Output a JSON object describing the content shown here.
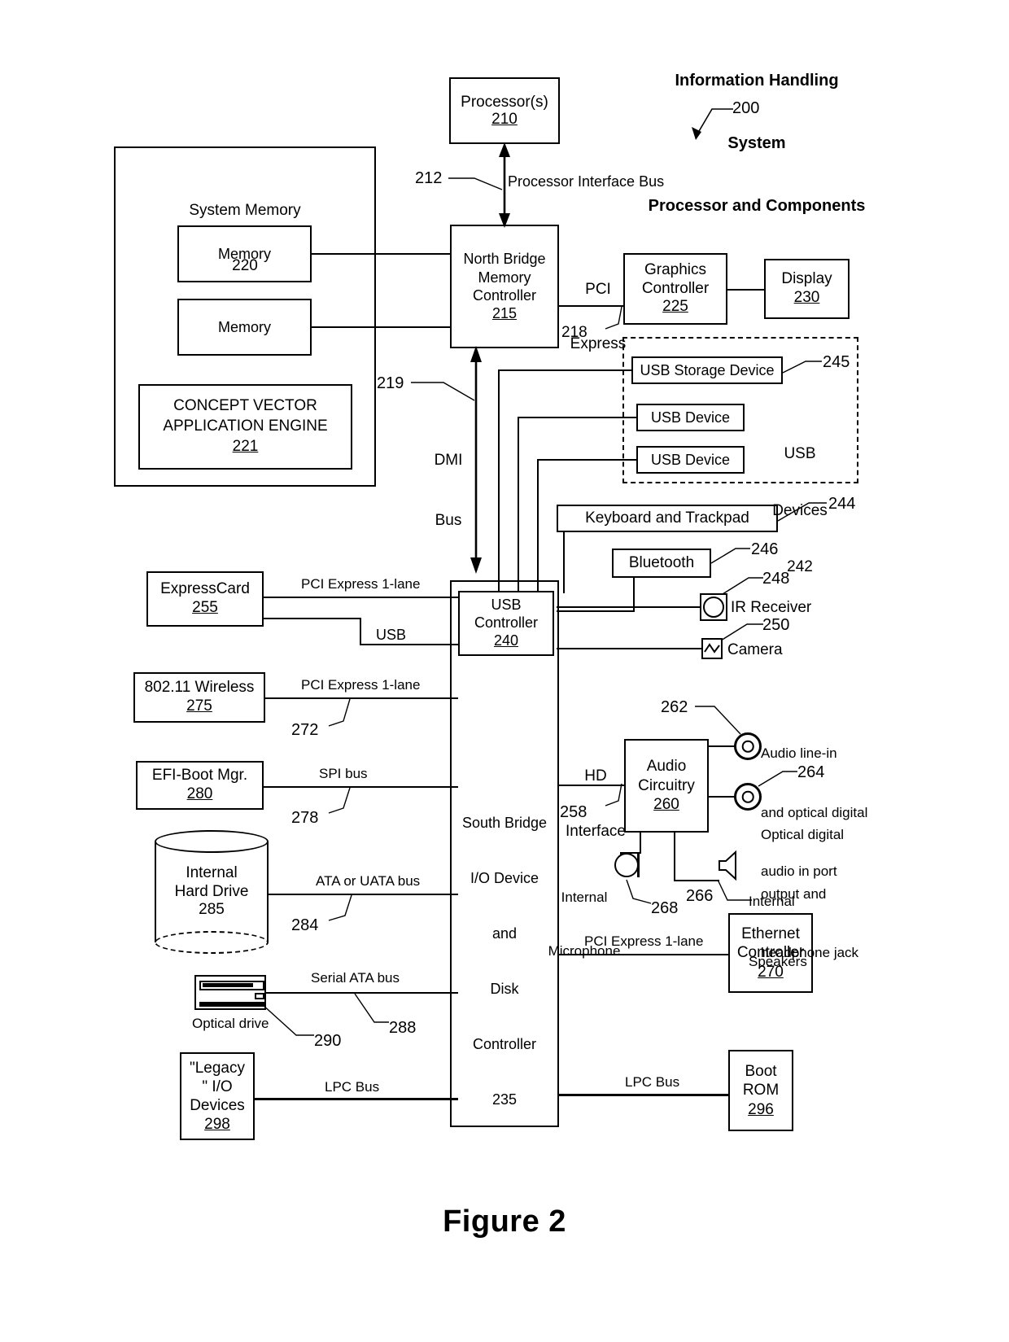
{
  "figure": {
    "label": "Figure 2",
    "title_lines": [
      "Information Handling",
      "System",
      "Processor and Components"
    ],
    "title_ref": "200"
  },
  "blocks": {
    "processor": {
      "name": "Processor(s)",
      "ref": "210"
    },
    "system_memory": {
      "name": "System Memory",
      "ref": "220"
    },
    "memory_1": {
      "name": "Memory"
    },
    "memory_2": {
      "name": "Memory"
    },
    "concept_vector": {
      "line1": "CONCEPT VECTOR",
      "line2": "APPLICATION ENGINE",
      "ref": "221"
    },
    "north_bridge": {
      "line1": "North Bridge",
      "line2": "Memory",
      "line3": "Controller",
      "ref": "215"
    },
    "graphics_controller": {
      "line1": "Graphics",
      "line2": "Controller",
      "ref": "225"
    },
    "display": {
      "name": "Display",
      "ref": "230"
    },
    "usb_storage_device": {
      "name": "USB Storage Device"
    },
    "usb_device_1": {
      "name": "USB Device"
    },
    "usb_device_2": {
      "name": "USB Device"
    },
    "usb_devices_group": {
      "line1": "USB",
      "line2": "Devices",
      "ref": "242"
    },
    "keyboard_trackpad": {
      "name": "Keyboard and Trackpad"
    },
    "bluetooth": {
      "name": "Bluetooth"
    },
    "ir_receiver": {
      "name": "IR Receiver"
    },
    "camera": {
      "name": "Camera"
    },
    "usb_controller": {
      "line1": "USB",
      "line2": "Controller",
      "ref": "240"
    },
    "south_bridge": {
      "line1": "South Bridge",
      "line2": "I/O Device",
      "line3": "and",
      "line4": "Disk",
      "line5": "Controller",
      "ref": "235"
    },
    "expresscard": {
      "name": "ExpressCard",
      "ref": "255"
    },
    "wireless": {
      "name": "802.11 Wireless",
      "ref": "275"
    },
    "efi_boot_mgr": {
      "name": "EFI-Boot Mgr.",
      "ref": "280"
    },
    "internal_hard_drive": {
      "line1": "Internal",
      "line2": "Hard Drive",
      "ref": "285"
    },
    "optical_drive": {
      "name": "Optical drive"
    },
    "legacy_io": {
      "line1": "\"Legacy",
      "line2": "\" I/O",
      "line3": "Devices",
      "ref": "298"
    },
    "audio_circuitry": {
      "line1": "Audio",
      "line2": "Circuitry",
      "ref": "260"
    },
    "ethernet_controller": {
      "line1": "Ethernet",
      "line2": "Controller",
      "ref": "270"
    },
    "boot_rom": {
      "line1": "Boot",
      "line2": "ROM",
      "ref": "296"
    },
    "internal_microphone": {
      "line1": "Internal",
      "line2": "Microphone"
    },
    "internal_speakers": {
      "line1": "Internal",
      "line2": "Speakers"
    },
    "audio_line_in": {
      "line1": "Audio line-in",
      "line2": "and optical digital",
      "line3": "audio in port"
    },
    "optical_digital_out": {
      "line1": "Optical digital",
      "line2": "output and",
      "line3": "headphone jack"
    }
  },
  "bus_labels": {
    "processor_interface_bus": "Processor Interface Bus",
    "pci_express": {
      "line1": "PCI",
      "line2": "Express"
    },
    "dmi_bus": {
      "line1": "DMI",
      "line2": "Bus"
    },
    "pci_express_1lane_expresscard": "PCI Express 1-lane",
    "usb": "USB",
    "pci_express_1lane_wireless": "PCI Express 1-lane",
    "spi_bus": "SPI bus",
    "ata_uata_bus": "ATA or UATA bus",
    "serial_ata_bus": "Serial ATA bus",
    "lpc_bus_left": "LPC Bus",
    "lpc_bus_right": "LPC Bus",
    "hd_interface": {
      "line1": "HD",
      "line2": "Interface"
    },
    "pci_express_1lane_ethernet": "PCI Express 1-lane"
  },
  "ref_numbers": {
    "r212": "212",
    "r218": "218",
    "r219": "219",
    "r244": "244",
    "r245": "245",
    "r246": "246",
    "r248": "248",
    "r250": "250",
    "r258": "258",
    "r262": "262",
    "r264": "264",
    "r266": "266",
    "r268": "268",
    "r272": "272",
    "r278": "278",
    "r284": "284",
    "r288": "288",
    "r290": "290"
  }
}
